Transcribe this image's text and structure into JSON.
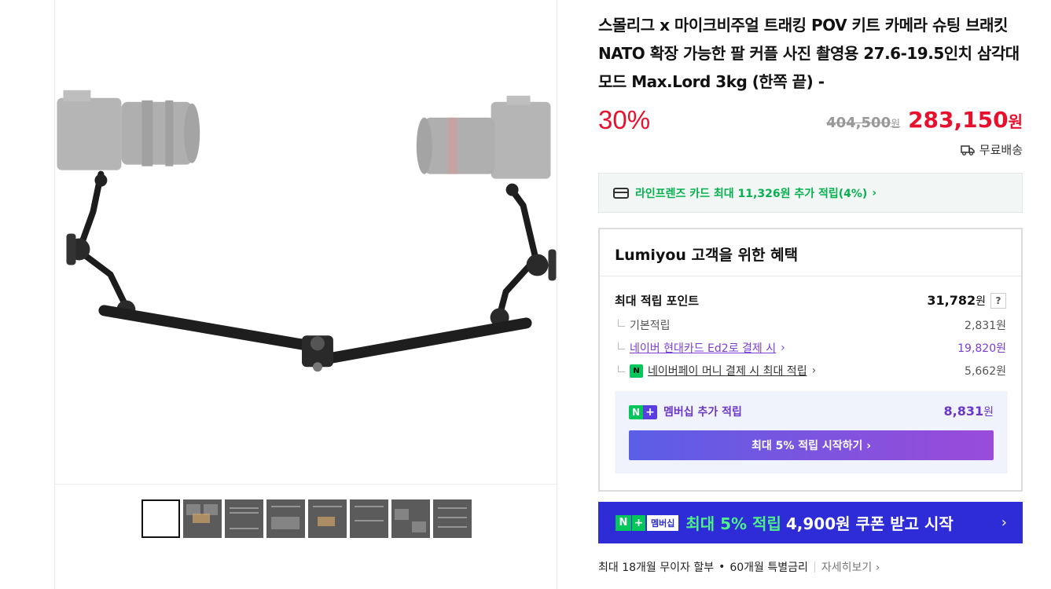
{
  "product": {
    "title": "스몰리그 x 마이크비주얼 트래킹 POV 키트 카메라 슈팅 브래킷 NATO 확장 가능한 팔 커플 사진 촬영용 27.6-19.5인치 삼각대 모드 Max.Lord 3kg (한쪽 끝) -",
    "discount": "30%",
    "original_price": "404,500",
    "original_unit": "원",
    "sale_price": "283,150",
    "sale_unit": "원",
    "shipping": "무료배송"
  },
  "card_promo": {
    "text": "라인프렌즈 카드 최대 11,326원 추가 적립(4%)",
    "arrow": "›"
  },
  "benefits": {
    "title": "Lumiyou 고객을 위한 혜택",
    "max_points_label": "최대 적립 포인트",
    "max_points_value": "31,782",
    "unit": "원",
    "help": "?",
    "rows": [
      {
        "label": "기본적립",
        "value": "2,831원"
      },
      {
        "label": "네이버 현대카드 Ed2로 결제 시",
        "value": "19,820원"
      },
      {
        "label": "네이버페이 머니 결제 시 최대 적립",
        "value": "5,662원"
      }
    ],
    "npay_icon": "N",
    "membership": {
      "label": "멤버십 추가 적립",
      "value": "8,831",
      "unit": "원",
      "button": "최대 5% 적립 시작하기 ›"
    }
  },
  "promo_banner": {
    "badge_n": "N",
    "badge_plus": "+",
    "badge_member": "멤버십",
    "highlight": "최대 5% 적립",
    "rest": "4,900원 쿠폰 받고 시작",
    "arrow": "›"
  },
  "installment": {
    "text1": "최대 18개월 무이자 할부",
    "dot": "•",
    "text2": "60개월 특별금리",
    "more": "자세히보기 ›"
  },
  "gallery": {
    "thumbnail_count": 8,
    "active_index": 0
  },
  "colors": {
    "price_red": "#e8112d",
    "naver_green": "#03c75a",
    "membership_purple": "#7a3ed6",
    "banner_blue": "#2d2cd6"
  }
}
